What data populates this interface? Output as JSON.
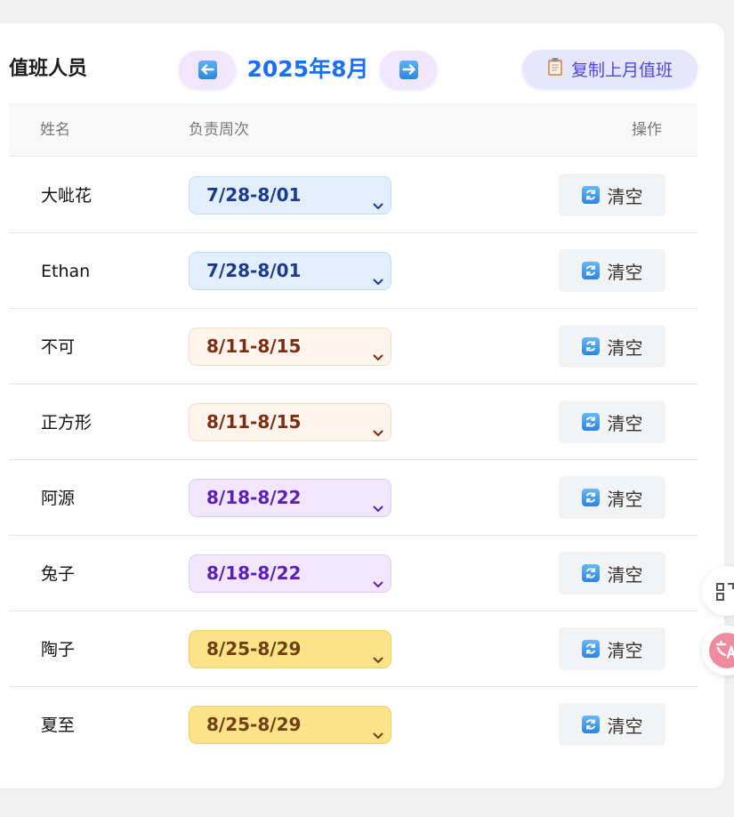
{
  "header": {
    "title": "值班人员",
    "month": "2025年8月",
    "copy_label": "复制上月值班",
    "prev_icon": "arrow-left-icon",
    "next_icon": "arrow-right-icon",
    "copy_icon": "clipboard-icon"
  },
  "table": {
    "columns": [
      "姓名",
      "负责周次",
      "操作"
    ],
    "clear_label": "清空",
    "rows": [
      {
        "name": "大呲花",
        "week": "7/28-8/01"
      },
      {
        "name": "Ethan",
        "week": "7/28-8/01"
      },
      {
        "name": "不可",
        "week": "8/11-8/15"
      },
      {
        "name": "正方形",
        "week": "8/11-8/15"
      },
      {
        "name": "阿源",
        "week": "8/18-8/22"
      },
      {
        "name": "兔子",
        "week": "8/18-8/22"
      },
      {
        "name": "陶子",
        "week": "8/25-8/29"
      },
      {
        "name": "夏至",
        "week": "8/25-8/29"
      }
    ]
  },
  "week_colors": {
    "7/28-8/01": {
      "bg": "#e1eefb",
      "border": "#c7dcf3",
      "text": "#1e3a8a"
    },
    "8/11-8/15": {
      "bg": "#fdf4ec",
      "border": "#f0dccb",
      "text": "#7c2d12"
    },
    "8/18-8/22": {
      "bg": "#f2e6fd",
      "border": "#dfcdf3",
      "text": "#5b21b6"
    },
    "8/25-8/29": {
      "bg": "#fbe38a",
      "border": "#ecd06a",
      "text": "#713f12"
    }
  },
  "floating": {
    "scan_icon": "qr-scan-icon",
    "translate_icon": "translate-icon"
  }
}
